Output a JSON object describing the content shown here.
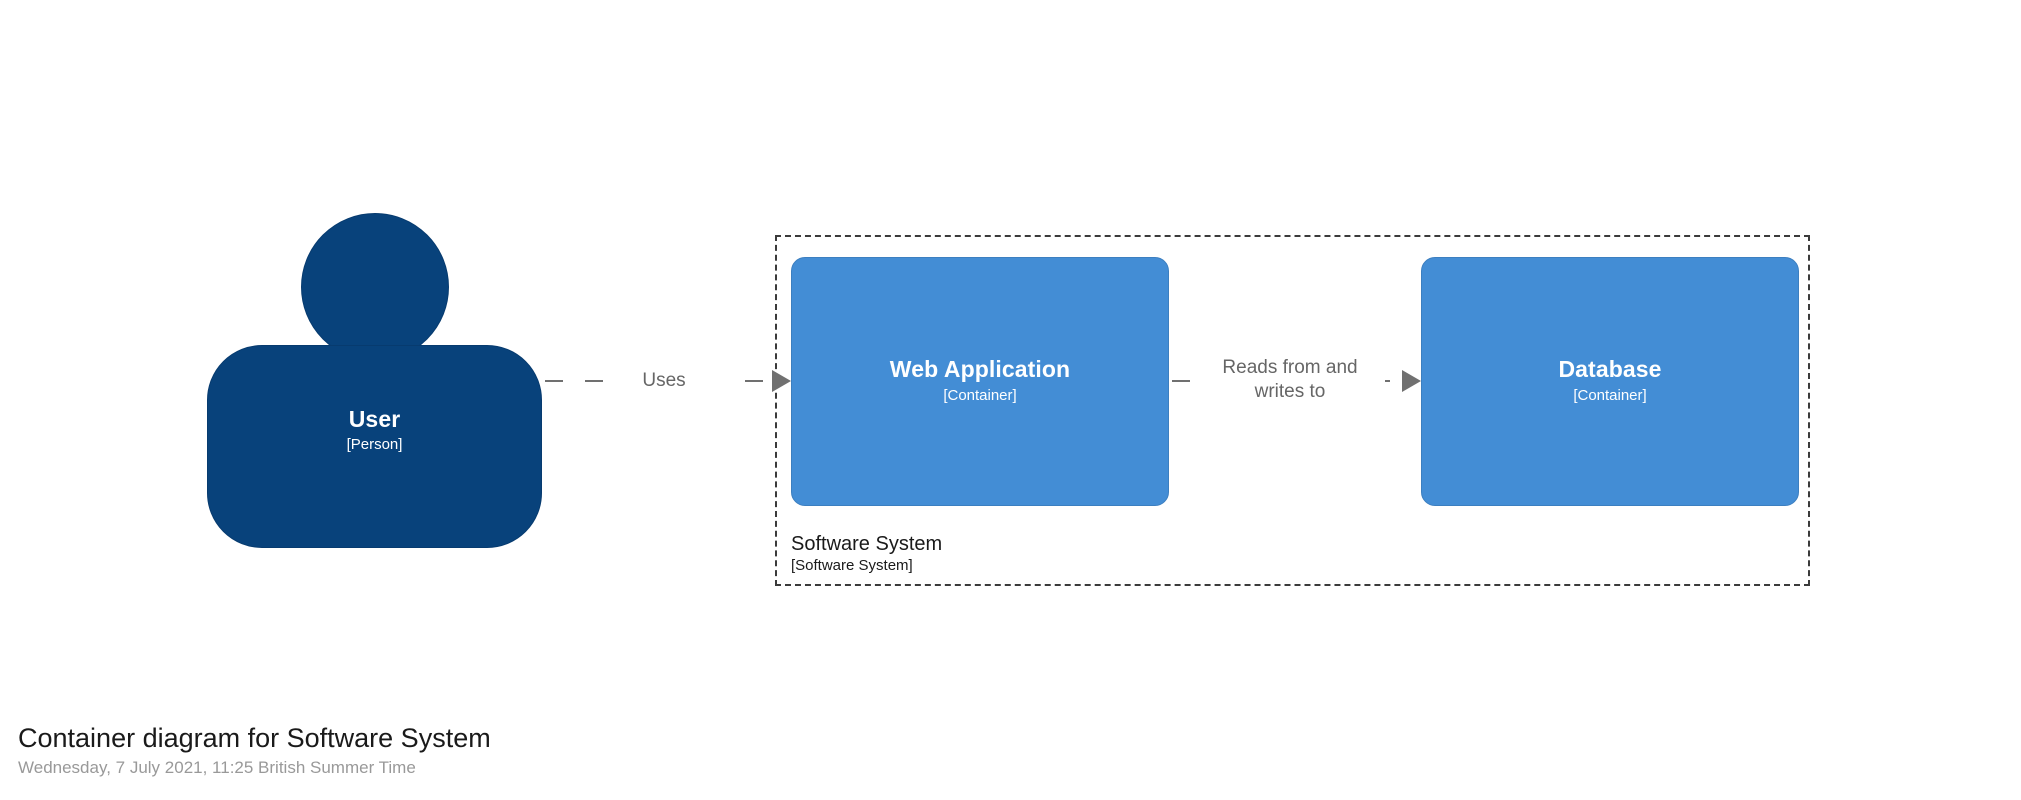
{
  "diagram": {
    "kind": "C4 Container diagram",
    "colors": {
      "person_fill": "#08427B",
      "person_stroke": "#073B6F",
      "container_fill": "#438DD5",
      "container_stroke": "#3C7FC0",
      "boundary_stroke": "#3B3B3B",
      "relationship_line": "#707070",
      "relationship_text": "#666666",
      "background": "#FFFFFF"
    },
    "elements": [
      {
        "id": "user",
        "name": "User",
        "type": "[Person]",
        "shape": "person"
      },
      {
        "id": "webapp",
        "name": "Web Application",
        "type": "[Container]",
        "shape": "rounded-box"
      },
      {
        "id": "database",
        "name": "Database",
        "type": "[Container]",
        "shape": "rounded-box"
      }
    ],
    "boundary": {
      "name": "Software System",
      "type": "[Software System]",
      "style": "dashed"
    },
    "relationships": [
      {
        "id": "user-uses-webapp",
        "source": "user",
        "destination": "webapp",
        "label": "Uses",
        "label_lines": [
          "Uses"
        ],
        "style": "dashed",
        "arrow": "solid-triangle"
      },
      {
        "id": "webapp-reads-writes-database",
        "source": "webapp",
        "destination": "database",
        "label": "Reads from and writes to",
        "label_lines": [
          "Reads from and",
          "writes to"
        ],
        "style": "dashed",
        "arrow": "solid-triangle"
      }
    ]
  },
  "caption": {
    "title": "Container diagram for Software System",
    "subtitle": "Wednesday, 7 July 2021, 11:25 British Summer Time"
  }
}
